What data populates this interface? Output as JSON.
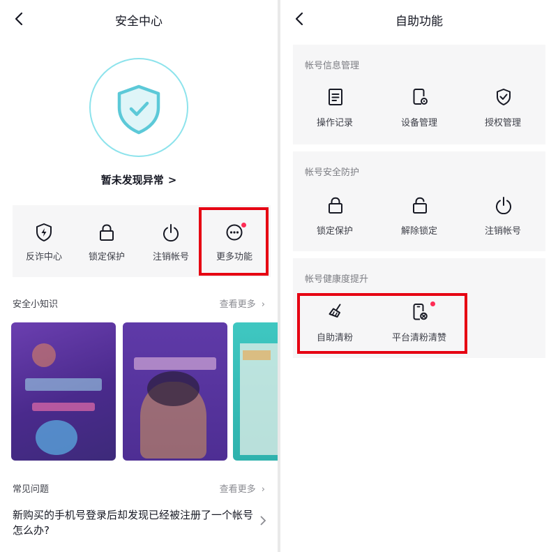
{
  "left": {
    "title": "安全中心",
    "status_text": "暂未发现异常",
    "status_chevron": ">",
    "tools": [
      {
        "label": "反诈中心",
        "icon": "shield-bolt-icon"
      },
      {
        "label": "锁定保护",
        "icon": "lock-icon"
      },
      {
        "label": "注销帐号",
        "icon": "power-icon"
      },
      {
        "label": "更多功能",
        "icon": "more-icon",
        "badge": true
      }
    ],
    "knowledge": {
      "title": "安全小知识",
      "more": "查看更多"
    },
    "faq": {
      "title": "常见问题",
      "more": "查看更多",
      "first_question": "新购买的手机号登录后却发现已经被注册了一个帐号怎么办?"
    }
  },
  "right": {
    "title": "自助功能",
    "groups": [
      {
        "title": "帐号信息管理",
        "items": [
          {
            "label": "操作记录",
            "icon": "document-icon"
          },
          {
            "label": "设备管理",
            "icon": "device-settings-icon"
          },
          {
            "label": "授权管理",
            "icon": "shield-check-icon"
          }
        ]
      },
      {
        "title": "帐号安全防护",
        "items": [
          {
            "label": "锁定保护",
            "icon": "lock-icon"
          },
          {
            "label": "解除锁定",
            "icon": "unlock-icon"
          },
          {
            "label": "注销帐号",
            "icon": "power-icon"
          }
        ]
      },
      {
        "title": "帐号健康度提升",
        "items": [
          {
            "label": "自助清粉",
            "icon": "broom-icon"
          },
          {
            "label": "平台清粉清赞",
            "icon": "phone-clear-icon",
            "badge": true
          }
        ]
      }
    ]
  },
  "colors": {
    "accent_red": "#e60012",
    "badge": "#fe2c55",
    "shield": "#5cc9d8",
    "card_bg": "#f6f6f7"
  }
}
